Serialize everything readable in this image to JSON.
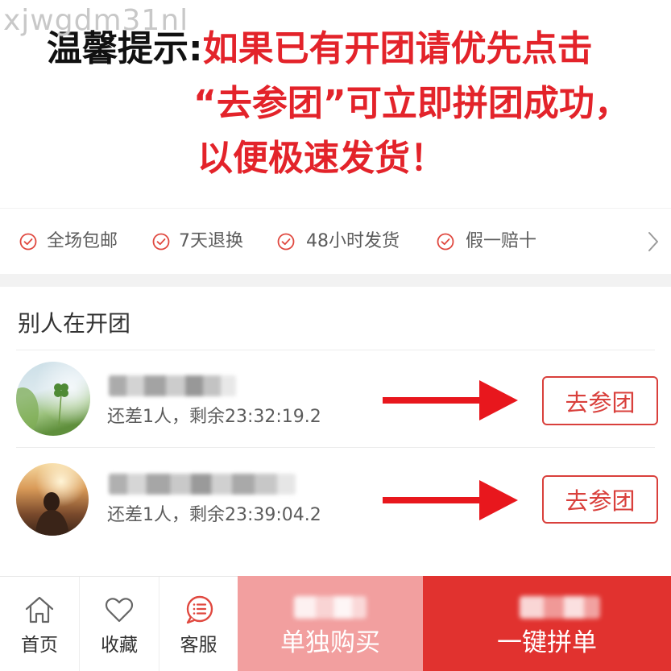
{
  "watermark": "xjwgdm31nl",
  "notice": {
    "prefix": "温馨提示:",
    "line1": "如果已有开团请优先点击",
    "line2": "“去参团”可立即拼团成功，",
    "line3": "以便极速发货！"
  },
  "services": {
    "items": [
      {
        "label": "全场包邮",
        "icon": "check-circle-icon"
      },
      {
        "label": "7天退换",
        "icon": "check-circle-icon"
      },
      {
        "label": "48小时发货",
        "icon": "check-circle-icon"
      },
      {
        "label": "假一赔十",
        "icon": "check-circle-icon"
      }
    ],
    "more_icon": "chevron-right-icon"
  },
  "groups": {
    "title": "别人在开团",
    "rows": [
      {
        "status": "还差1人，剩余23:32:19.2",
        "join_label": "去参团",
        "arrow_icon": "red-arrow-right-icon"
      },
      {
        "status": "还差1人，剩余23:39:04.2",
        "join_label": "去参团",
        "arrow_icon": "red-arrow-right-icon"
      }
    ]
  },
  "bottom_bar": {
    "home": {
      "label": "首页",
      "icon": "home-icon"
    },
    "favorite": {
      "label": "收藏",
      "icon": "heart-icon"
    },
    "customer_service": {
      "label": "客服",
      "icon": "chat-icon"
    },
    "buy_alone_label": "单独购买",
    "group_buy_label": "一键拼单"
  },
  "colors": {
    "accent_red": "#e3232a",
    "button_red": "#d9403c",
    "check_red": "#e0483f",
    "buy_alone_bg": "#f29f9f",
    "group_buy_bg": "#e1322f"
  }
}
